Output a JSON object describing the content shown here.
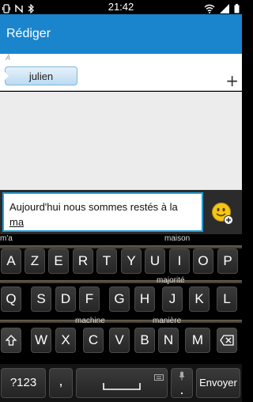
{
  "status_bar": {
    "time": "21:42",
    "left_icons": [
      "vibrate-icon",
      "nfc-icon",
      "bluetooth-icon"
    ],
    "right_icons": [
      "wifi-icon",
      "signal-icon",
      "battery-icon"
    ]
  },
  "header": {
    "title": "Rédiger"
  },
  "recipients": {
    "label": "À",
    "chips": [
      {
        "label": "julien"
      }
    ],
    "add_label": "+"
  },
  "composer": {
    "message_line1": "Aujourd'hui nous sommes restés à la",
    "message_line2": "ma",
    "emoji_icon": "emoji-add-icon"
  },
  "keyboard": {
    "suggestions": {
      "row1_left": "m'a",
      "row1_center": "maison",
      "row2_right": "majorité",
      "row3_left": "machine",
      "row3_right": "manière"
    },
    "row1": [
      "A",
      "Z",
      "E",
      "R",
      "T",
      "Y",
      "U",
      "I",
      "O",
      "P"
    ],
    "row2": [
      "Q",
      "S",
      "D",
      "F",
      "G",
      "H",
      "J",
      "K",
      "L"
    ],
    "row3": [
      "W",
      "X",
      "C",
      "V",
      "B",
      "N",
      "M"
    ],
    "shift_icon": "shift-icon",
    "backspace_icon": "backspace-icon",
    "symbols_label": "?123",
    "comma_label": ",",
    "space_icon": "spacebar-icon",
    "period_label": ".",
    "send_label": "Envoyer"
  },
  "colors": {
    "accent": "#1a85cc",
    "input_border": "#1fa0d8"
  }
}
